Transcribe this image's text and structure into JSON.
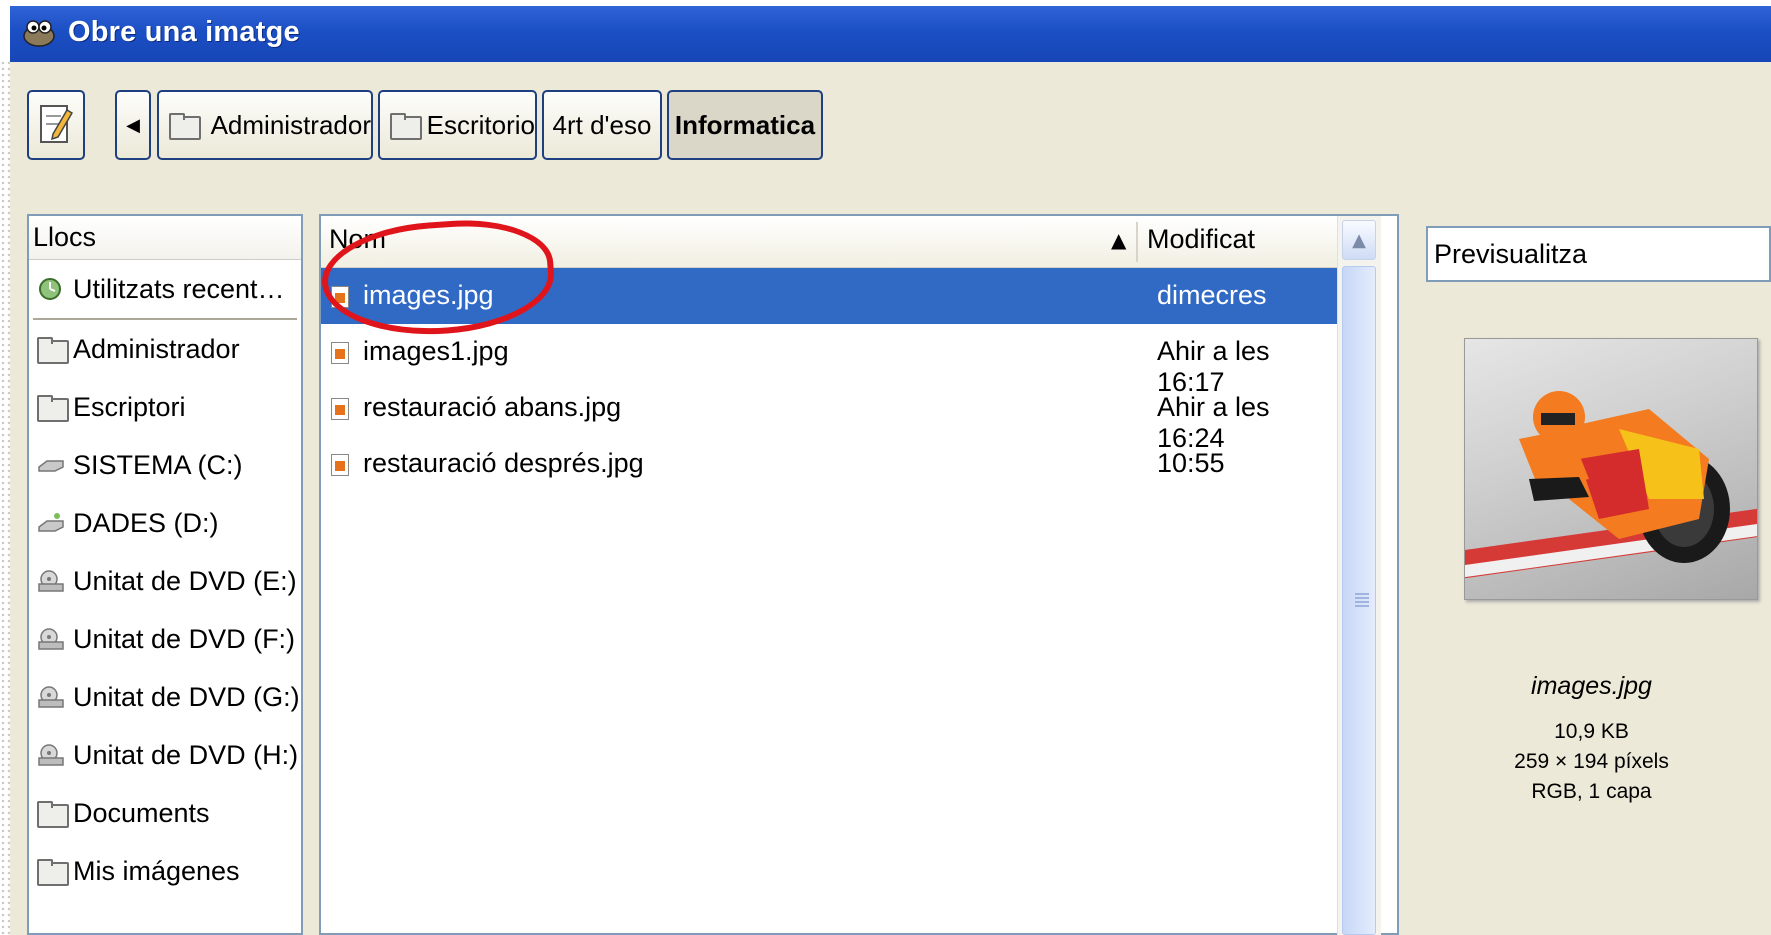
{
  "window": {
    "title": "Obre una imatge"
  },
  "toolbar": {
    "breadcrumb": [
      "Administrador",
      "Escritorio",
      "4rt d'eso",
      "Informatica"
    ]
  },
  "places": {
    "header": "Llocs",
    "items": [
      "Utilitzats recent…",
      "Administrador",
      "Escriptori",
      "SISTEMA (C:)",
      "DADES (D:)",
      "Unitat de DVD (E:)",
      "Unitat de DVD (F:)",
      "Unitat de DVD (G:)",
      "Unitat de DVD (H:)",
      "Documents",
      "Mis imágenes"
    ]
  },
  "files": {
    "col_name": "Nom",
    "col_modified": "Modificat",
    "rows": [
      {
        "name": "images.jpg",
        "modified": "dimecres",
        "selected": true
      },
      {
        "name": "images1.jpg",
        "modified": "Ahir a les 16:17"
      },
      {
        "name": "restauració abans.jpg",
        "modified": "Ahir a les 16:24"
      },
      {
        "name": "restauració després.jpg",
        "modified": "10:55"
      }
    ]
  },
  "preview": {
    "toggle_label": "Previsualitza",
    "filename": "images.jpg",
    "size": "10,9 KB",
    "dimensions": "259 × 194 píxels",
    "mode": "RGB, 1 capa"
  },
  "colors": {
    "titlebar": "#1b4fc4",
    "selection": "#316ac5",
    "annotation": "#e0151b"
  }
}
